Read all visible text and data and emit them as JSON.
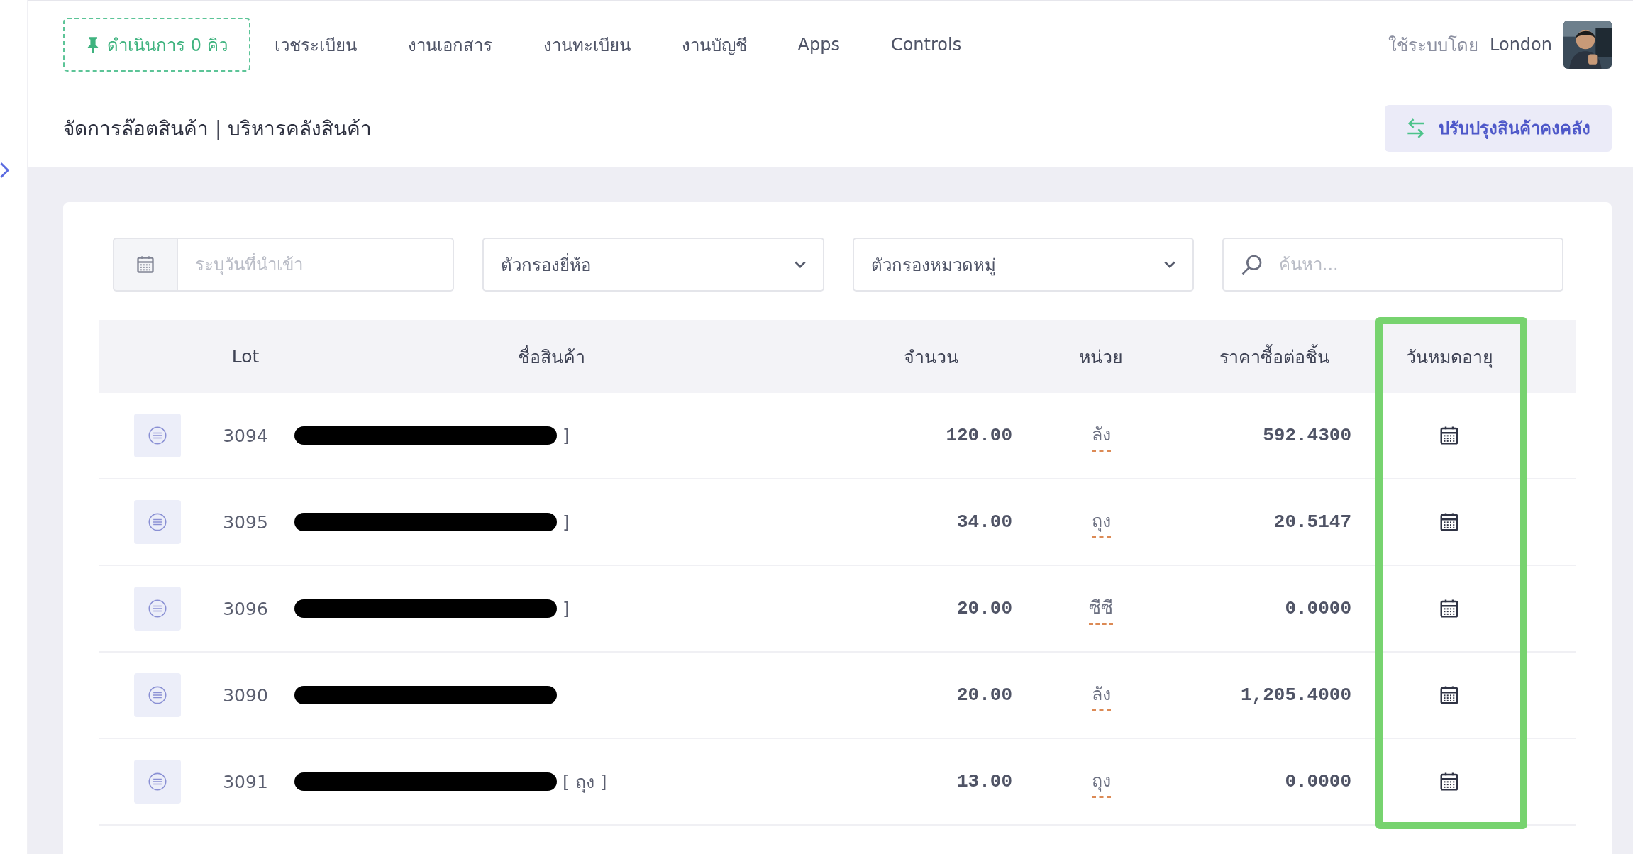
{
  "nav": {
    "queue_button": "ดำเนินการ 0 คิว",
    "items": [
      "เวชระเบียน",
      "งานเอกสาร",
      "งานทะเบียน",
      "งานบัญชี",
      "Apps",
      "Controls"
    ],
    "user_label": "ใช้ระบบโดย",
    "user_name": "London"
  },
  "page": {
    "title": "จัดการล๊อตสินค้า | บริหารคลังสินค้า",
    "action_button": "ปรับปรุงสินค้าคงคลัง"
  },
  "filters": {
    "date_placeholder": "ระบุวันที่นำเข้า",
    "brand_filter": "ตัวกรองยี่ห้อ",
    "category_filter": "ตัวกรองหมวดหมู่",
    "search_placeholder": "ค้นหา..."
  },
  "table": {
    "columns": [
      {
        "label": "Lot",
        "highlighted": false
      },
      {
        "label": "ชื่อสินค้า",
        "highlighted": false
      },
      {
        "label": "จำนวน",
        "highlighted": false
      },
      {
        "label": "หน่วย",
        "highlighted": false
      },
      {
        "label": "ราคาซื้อต่อชิ้น",
        "highlighted": false
      },
      {
        "label": "วันหมดอายุ",
        "highlighted": true
      }
    ],
    "rows": [
      {
        "lot": "3094",
        "name_visible": "]",
        "quantity": "120.00",
        "unit": "ลัง",
        "price": "592.4300"
      },
      {
        "lot": "3095",
        "name_visible": "]",
        "quantity": "34.00",
        "unit": "ถุง",
        "price": "20.5147"
      },
      {
        "lot": "3096",
        "name_visible": "]",
        "quantity": "20.00",
        "unit": "ซีซี",
        "price": "0.0000"
      },
      {
        "lot": "3090",
        "quantity": "20.00",
        "unit": "ลัง",
        "price": "1,205.4000"
      },
      {
        "lot": "3091",
        "name_visible": "[ ถุง ]",
        "quantity": "13.00",
        "unit": "ถุง",
        "price": "0.0000"
      }
    ]
  }
}
